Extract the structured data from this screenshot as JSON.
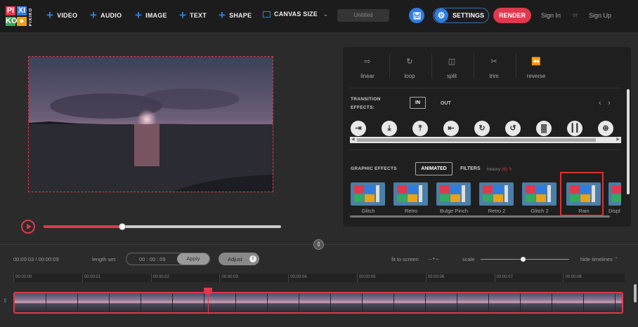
{
  "logo": {
    "tiles": [
      {
        "text": "PI",
        "color": "#e0384d"
      },
      {
        "text": "XI",
        "color": "#2f7de1"
      },
      {
        "text": "KO",
        "color": "#3aa85a"
      },
      {
        "text": "●",
        "color": "#e8a317"
      }
    ],
    "side_text": "PIXIKO",
    "accent_colors": [
      "#e0384d",
      "#2f7de1",
      "#3aa85a",
      "#e8a317"
    ]
  },
  "topbar": {
    "menu": [
      {
        "label": "VIDEO",
        "icon": "plus-icon"
      },
      {
        "label": "AUDIO",
        "icon": "plus-icon"
      },
      {
        "label": "IMAGE",
        "icon": "plus-icon"
      },
      {
        "label": "TEXT",
        "icon": "plus-icon"
      },
      {
        "label": "SHAPE",
        "icon": "plus-icon"
      }
    ],
    "canvas_size": "CANVAS SIZE",
    "project_name": "Untitled",
    "settings": "SETTINGS",
    "render": "RENDER",
    "sign_in": "Sign In",
    "or": "or",
    "sign_up": "Sign Up",
    "brand_blue": "#2f7de1",
    "brand_red": "#e0384d"
  },
  "player": {
    "progress": 0.33
  },
  "tools": [
    {
      "label": "linear",
      "icon": "linear-arrow-icon"
    },
    {
      "label": "loop",
      "icon": "loop-icon"
    },
    {
      "label": "split",
      "icon": "split-icon"
    },
    {
      "label": "trim",
      "icon": "scissors-icon"
    },
    {
      "label": "reverse",
      "icon": "rewind-icon"
    }
  ],
  "transitions": {
    "label_line1": "TRANSITION",
    "label_line2": "EFFECTS:",
    "tab_in": "IN",
    "tab_out": "OUT",
    "icons": [
      "arrow-right-bar-icon",
      "arrow-down-icon",
      "arrow-up-icon",
      "arrow-left-bar-icon",
      "rotate-cw-icon",
      "rotate-ccw-icon",
      "checker-fade-icon",
      "bars-icon",
      "zoom-in-icon"
    ]
  },
  "graphic_effects": {
    "label": "GRAPHIC EFFECTS",
    "tab_animated": "ANIMATED",
    "tab_filters": "FILTERS",
    "history": "history",
    "history_count": "(6)",
    "items": [
      {
        "label": "Glitch"
      },
      {
        "label": "Retro"
      },
      {
        "label": "Bulge Pinch"
      },
      {
        "label": "Retro 2"
      },
      {
        "label": "Glitch 2"
      },
      {
        "label": "Rain"
      },
      {
        "label": "Displ"
      }
    ],
    "selected": "Rain"
  },
  "timeline": {
    "time": "00:00:03 / 00:00:09",
    "length_label": "length set:",
    "length_value": "00 : 00 : 09",
    "apply": "Apply",
    "adjust": "Adjust",
    "fit_to_screen": "fit to screen",
    "scale": "scale",
    "scale_level": 0.48,
    "hide_timelines": "hide timelines",
    "ticks": [
      "00:00:00",
      "00:00:01",
      "00:00:02",
      "00:00:03",
      "00:00:04",
      "00:00:05",
      "00:00:06",
      "00:00:07",
      "00:00:08"
    ],
    "playhead": 0.318
  }
}
